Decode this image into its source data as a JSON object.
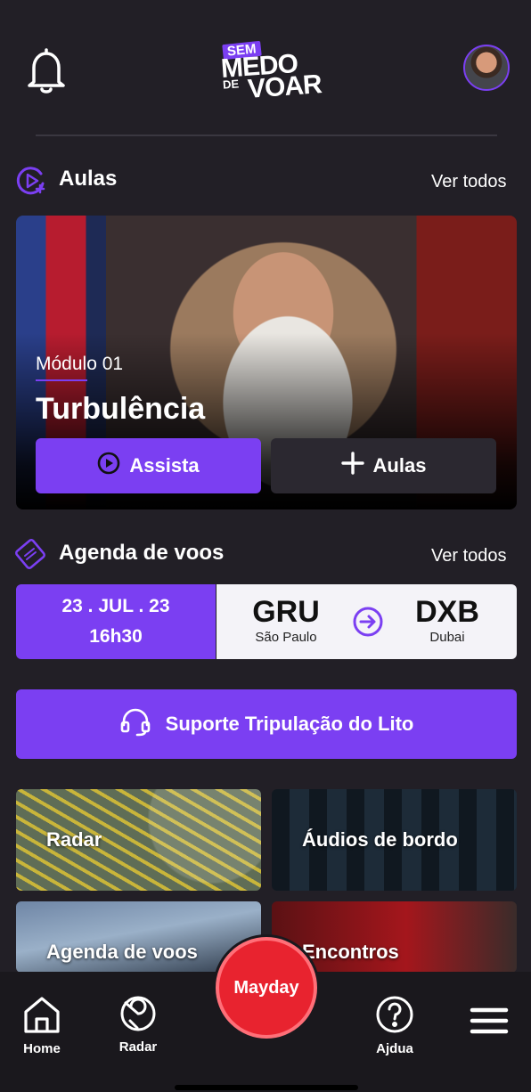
{
  "header": {
    "logo": {
      "line1": "SEM",
      "line2": "MEDO",
      "line3": "DE",
      "line4": "VOAR"
    }
  },
  "aulas": {
    "title": "Aulas",
    "see_all": "Ver todos",
    "hero": {
      "module": "Módulo 01",
      "title": "Turbulência",
      "watch_label": "Assista",
      "more_label": "Aulas"
    }
  },
  "agenda": {
    "title": "Agenda de voos",
    "see_all": "Ver todos",
    "flight": {
      "date": "23 . JUL . 23",
      "time": "16h30",
      "origin_code": "GRU",
      "origin_city": "São Paulo",
      "dest_code": "DXB",
      "dest_city": "Dubai"
    }
  },
  "support": {
    "label": "Suporte Tripulação do Lito"
  },
  "tiles": [
    {
      "label": "Radar"
    },
    {
      "label": "Áudios de bordo"
    },
    {
      "label": "Agenda de voos"
    },
    {
      "label": "Encontros"
    }
  ],
  "nav": {
    "home": "Home",
    "radar": "Radar",
    "mayday": "Mayday",
    "help": "Ajdua"
  },
  "colors": {
    "accent": "#7b3ff2",
    "background": "#221f26",
    "mayday": "#e8232f"
  }
}
